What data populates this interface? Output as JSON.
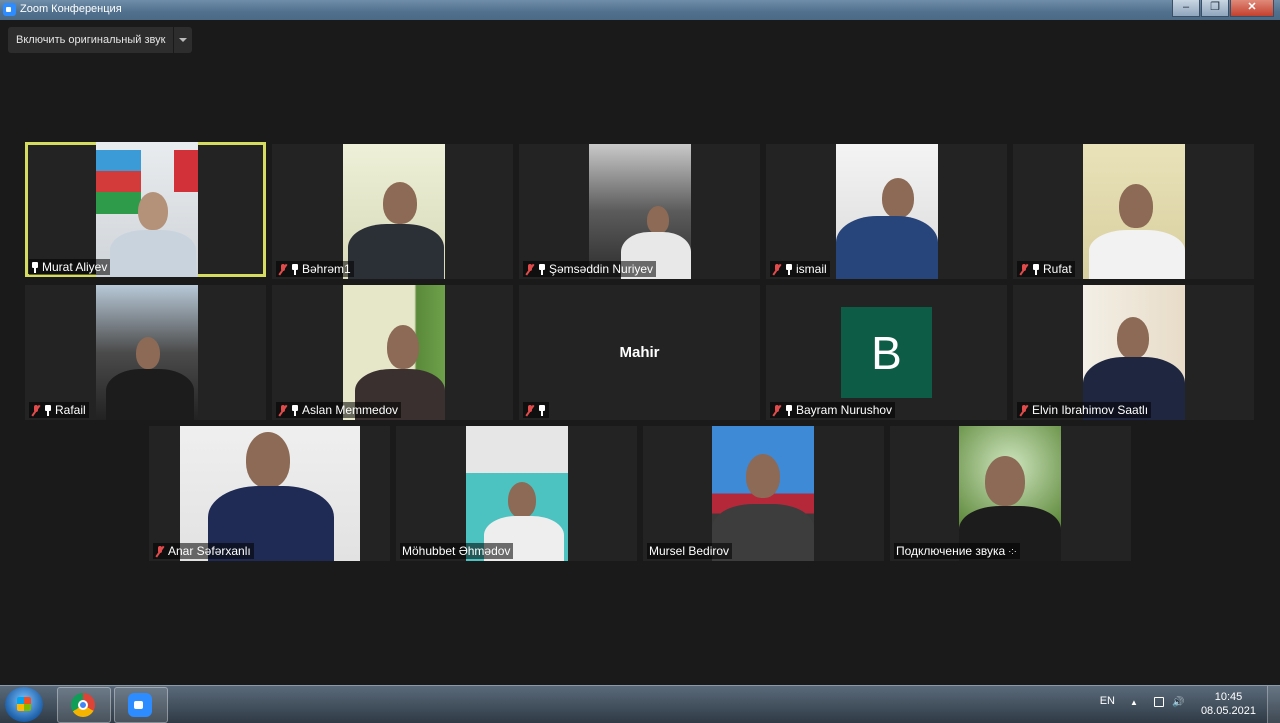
{
  "window": {
    "title": "Zoom Конференция",
    "minimize": "–",
    "maximize": "❐",
    "close": "✕"
  },
  "toolbar": {
    "original_sound_label": "Включить оригинальный звук"
  },
  "participants": [
    {
      "name": "Murat Aliyev",
      "muted": false,
      "pinned": true,
      "active": true
    },
    {
      "name": "Bəhrəm1",
      "muted": true,
      "pinned": true
    },
    {
      "name": "Şəmsəddin Nuriyev",
      "muted": true,
      "pinned": true
    },
    {
      "name": "ismail",
      "muted": true,
      "pinned": true
    },
    {
      "name": "Rufat",
      "muted": true,
      "pinned": true
    },
    {
      "name": "Rafail",
      "muted": true,
      "pinned": true
    },
    {
      "name": "Aslan Memmedov",
      "muted": true,
      "pinned": true
    },
    {
      "name": "Mahir",
      "muted": true,
      "pinned": true,
      "video": false
    },
    {
      "name": "Bayram Nurushov",
      "muted": true,
      "pinned": true,
      "avatar_letter": "B",
      "avatar_color": "#0d5c46"
    },
    {
      "name": "Elvin Ibrahimov Saatlı",
      "muted": true,
      "pinned": false
    },
    {
      "name": "Anar Səfərxanlı",
      "muted": true,
      "pinned": false
    },
    {
      "name": "Möhubbet Əhmədov",
      "muted": false,
      "pinned": false
    },
    {
      "name": "Mursel Bedirov",
      "muted": false,
      "pinned": false
    },
    {
      "name": "Подключение звука",
      "muted": false,
      "pinned": false,
      "connecting": true
    }
  ],
  "taskbar": {
    "apps": [
      "chrome-icon",
      "zoom-icon"
    ],
    "language": "EN",
    "tray_up": "▲",
    "time": "10:45",
    "date": "08.05.2021"
  },
  "colors": {
    "active_speaker": "#d6dc5f",
    "avatar_bg": "#0d5c46",
    "muted_icon": "#e24b4b"
  }
}
